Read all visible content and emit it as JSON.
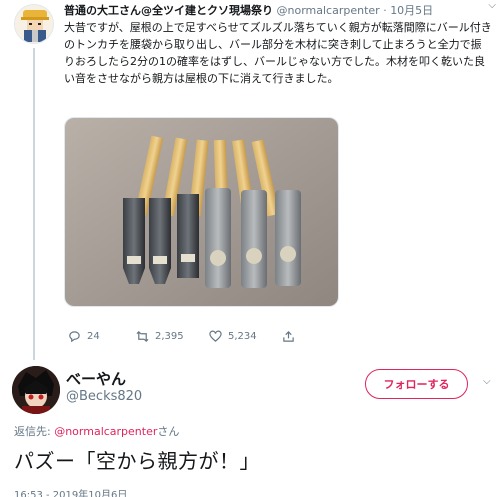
{
  "parent_tweet": {
    "display_name": "普通の大工さん@全ツイ建とクソ現場祭り",
    "handle": "@normalcarpenter",
    "dot": "·",
    "date": "10月5日",
    "text": "大昔ですが、屋根の上で足すべらせてズルズル落ちていく親方が転落間際にバール付きのトンカチを腰袋から取り出し、バール部分を木材に突き刺して止まろうと全力で振りおろしたら2分の1の確率をはずし、バールじゃない方でした。木材を叩く乾いた良い音をさせながら親方は屋根の下に消えて行きました。",
    "photo_icon": "photo-of-six-claw-hammers",
    "actions": {
      "reply_count": "24",
      "retweet_count": "2,395",
      "like_count": "5,234"
    }
  },
  "main_tweet": {
    "display_name": "べーやん",
    "handle": "@Becks820",
    "follow_label": "フォローする",
    "replying_prefix": "返信先: ",
    "replying_mention": "@normalcarpenter",
    "replying_suffix": "さん",
    "text": "パズー「空から親方が！」",
    "timestamp": "16:53 - 2019年10月6日"
  },
  "colors": {
    "accent": "#e0245e",
    "muted": "#657786",
    "text": "#14171a",
    "divider": "#ccd6dd"
  }
}
